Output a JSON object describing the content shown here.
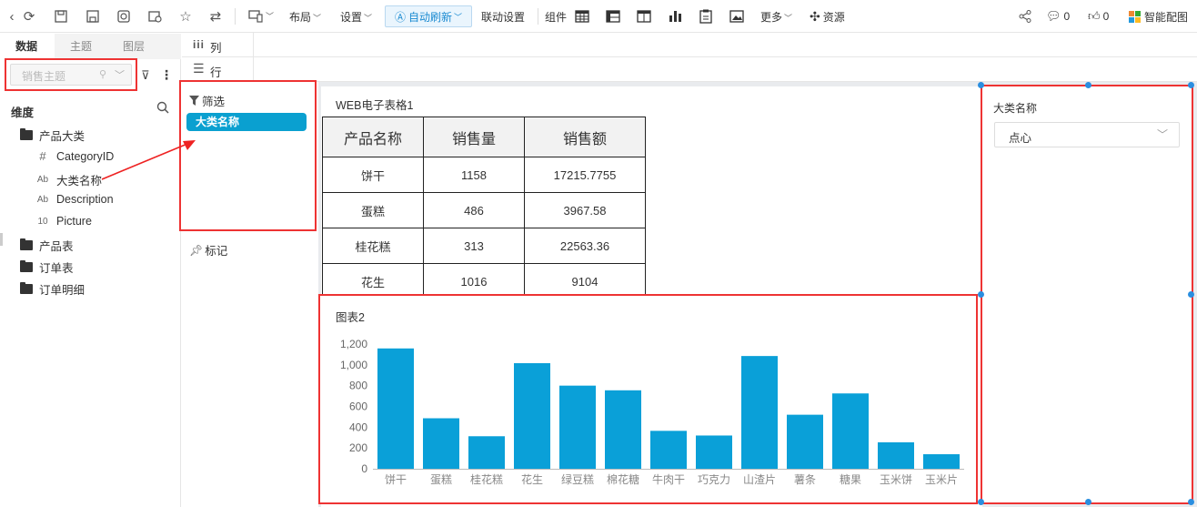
{
  "toolbar": {
    "layout": "布局",
    "settings": "设置",
    "auto_refresh": "自动刷新",
    "link_settings": "联动设置",
    "components": "组件",
    "more": "更多",
    "resources": "资源",
    "comment_count": "0",
    "like_count": "0",
    "smart_config": "智能配图"
  },
  "left": {
    "tabs": [
      "数据",
      "主题",
      "图层"
    ],
    "search_placeholder": "销售主题",
    "dimension_label": "维度",
    "tree": {
      "category_folder": "产品大类",
      "fields": [
        {
          "icon": "#",
          "name": "CategoryID"
        },
        {
          "icon": "Ab",
          "name": "大类名称"
        },
        {
          "icon": "Ab",
          "name": "Description"
        },
        {
          "icon": "10",
          "name": "Picture"
        }
      ],
      "folders": [
        "产品表",
        "订单表",
        "订单明细"
      ]
    }
  },
  "shelves": {
    "columns": "列",
    "rows": "行",
    "filter": "筛选",
    "filter_pill": "大类名称",
    "marks": "标记"
  },
  "table": {
    "title": "WEB电子表格1",
    "headers": [
      "产品名称",
      "销售量",
      "销售额"
    ],
    "rows": [
      [
        "饼干",
        "1158",
        "17215.7755"
      ],
      [
        "蛋糕",
        "486",
        "3967.58"
      ],
      [
        "桂花糕",
        "313",
        "22563.36"
      ],
      [
        "花生",
        "1016",
        "9104"
      ]
    ]
  },
  "chart": {
    "title": "图表2"
  },
  "chart_data": {
    "type": "bar",
    "categories": [
      "饼干",
      "蛋糕",
      "桂花糕",
      "花生",
      "绿豆糕",
      "棉花糖",
      "牛肉干",
      "巧克力",
      "山渣片",
      "薯条",
      "糖果",
      "玉米饼",
      "玉米片"
    ],
    "values": [
      1158,
      486,
      313,
      1016,
      800,
      755,
      365,
      320,
      1085,
      520,
      725,
      255,
      140
    ],
    "yticks": [
      "0",
      "200",
      "400",
      "600",
      "800",
      "1,000",
      "1,200"
    ],
    "ylim": [
      0,
      1200
    ],
    "color": "#0aa0d8",
    "grid": false
  },
  "filter_widget": {
    "label": "大类名称",
    "value": "点心"
  }
}
